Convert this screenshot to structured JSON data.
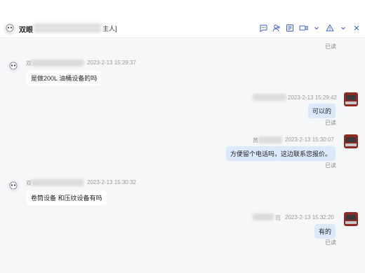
{
  "header": {
    "contact_name": "双眼",
    "contact_suffix": "主人]",
    "icons": [
      "chat-bubble-icon",
      "contact-add-icon",
      "note-icon",
      "video-icon",
      "more-down-icon",
      "alert-icon",
      "expand-icon"
    ]
  },
  "messages": [
    {
      "side": "left",
      "sender_frag": "双",
      "time": "2023-2-13 15:29:37",
      "text": "是做200L 油桶设备的吗"
    },
    {
      "side": "right",
      "time": "2023-2-13 15:29:42",
      "text": "可以的",
      "status": "已读"
    },
    {
      "side": "right",
      "sender_frag": "黄",
      "time": "2023-2-13 15:30:07",
      "text": "方便留个电话吗，这边联系您报价。",
      "status": "已读"
    },
    {
      "side": "left",
      "sender_frag": "双",
      "time": "2023-2-13 15:30:32",
      "text": "卷筒设备 和压纹设备有吗"
    },
    {
      "side": "right",
      "sender_frag": "司",
      "time": "2023-2-13 15:32:20",
      "text": "有的",
      "status": "已读"
    }
  ],
  "top_status": "已读",
  "colors": {
    "bubble_right": "#dce9fb",
    "bubble_left": "#ffffff",
    "chat_bg": "#f6f7f9"
  }
}
